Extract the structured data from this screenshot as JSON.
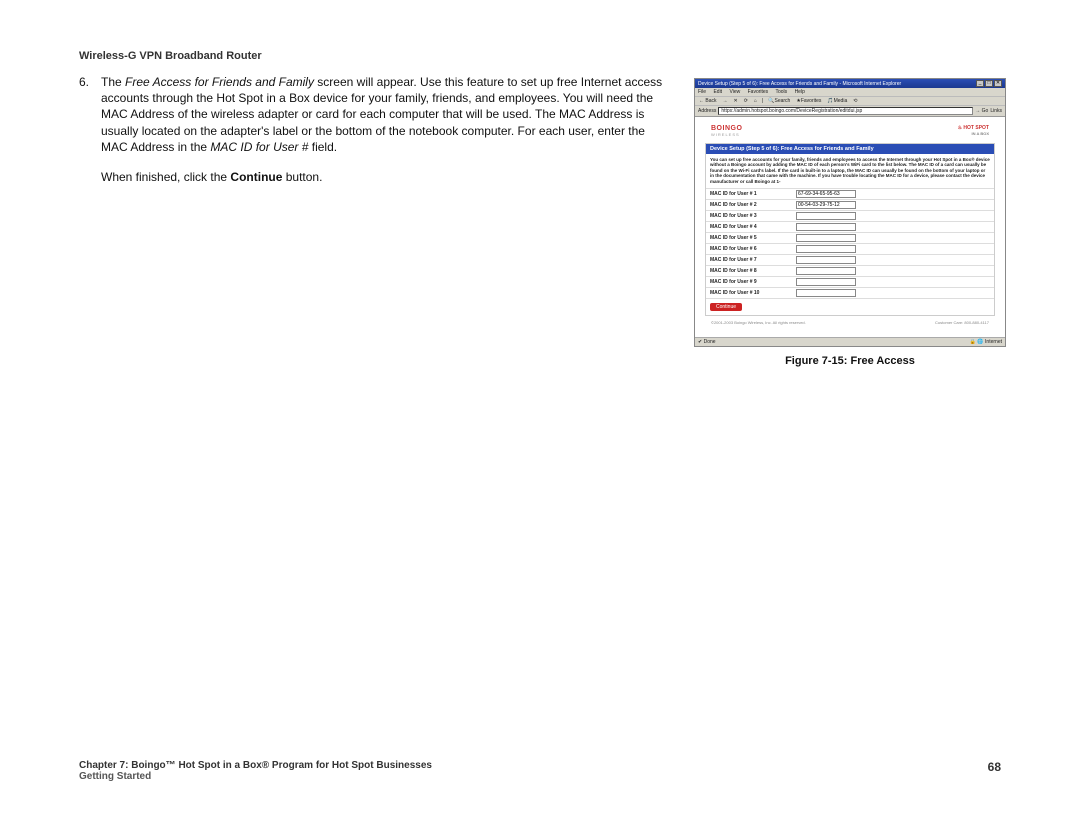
{
  "header": {
    "title": "Wireless-G VPN Broadband Router"
  },
  "body": {
    "step_number": "6.",
    "para1_prefix": "The ",
    "para1_italic": "Free Access for Friends and Family",
    "para1_mid": " screen will appear. Use this feature to set up free Internet access accounts through the Hot Spot in a Box device for your family, friends, and employees. You will need the MAC Address of the wireless adapter or card for each computer that will be used. The MAC Address is usually located on the adapter's label or the bottom of the notebook computer. For each user, enter the MAC Address in the ",
    "para1_italic2": "MAC ID for User #",
    "para1_suffix": " field.",
    "para2_prefix": "When finished, click the ",
    "para2_bold": "Continue",
    "para2_suffix": " button."
  },
  "figure": {
    "window_title": "Device Setup (Step 5 of 6): Free Access for Friends and Family - Microsoft Internet Explorer",
    "menu": {
      "file": "File",
      "edit": "Edit",
      "view": "View",
      "favorites": "Favorites",
      "tools": "Tools",
      "help": "Help"
    },
    "toolbar": {
      "back": "← Back",
      "fwd": "→",
      "stop": "✕",
      "refresh": "⟳",
      "home": "⌂",
      "search": "🔍Search",
      "favorites": "★Favorites",
      "media": "🎵Media",
      "history": "⟲"
    },
    "address_label": "Address",
    "address_url": "https://admin.hotspot.boingo.com/DeviceRegistration/editdui.jsp",
    "go": "→ Go",
    "links": "Links",
    "boingo": "BOINGO",
    "boingo_sub": "WIRELESS",
    "hotspot": "♨ HOT SPOT",
    "hotspot_sub": "IN A BOX",
    "blue_bar": "Device Setup (Step 5 of 6): Free Access for Friends and Family",
    "instructions": "You can set up free accounts for your family, friends and employees to access the Internet through your Hot Spot in a Box® device without a Boingo account by adding the MAC ID of each person's WiFi card to the list below. The MAC ID of a card can usually be found on the Wi-Fi card's label. If the card is built-in to a laptop, the MAC ID can usually be found on the bottom of your laptop or in the documentation that came with the machine. If you have trouble locating the MAC ID for a device, please contact the device manufacturer or call Boingo at 1-",
    "rows": [
      {
        "label": "MAC ID for User # 1",
        "value": "67-69-34-65-95-63"
      },
      {
        "label": "MAC ID for User # 2",
        "value": "00-54-03-29-75-12"
      },
      {
        "label": "MAC ID for User # 3",
        "value": ""
      },
      {
        "label": "MAC ID for User # 4",
        "value": ""
      },
      {
        "label": "MAC ID for User # 5",
        "value": ""
      },
      {
        "label": "MAC ID for User # 6",
        "value": ""
      },
      {
        "label": "MAC ID for User # 7",
        "value": ""
      },
      {
        "label": "MAC ID for User # 8",
        "value": ""
      },
      {
        "label": "MAC ID for User # 9",
        "value": ""
      },
      {
        "label": "MAC ID for User # 10",
        "value": ""
      }
    ],
    "continue": "Continue",
    "footer_left": "©2001-2003 Boingo Wireless, Inc. All rights reserved.",
    "footer_right": "Customer Care: 800-880-4117",
    "status_done": "✔ Done",
    "status_zone": "🔒 🌐 Internet",
    "caption": "Figure 7-15: Free Access"
  },
  "footer": {
    "chapter": "Chapter 7: Boingo™ Hot Spot in a Box® Program for Hot Spot Businesses",
    "section": "Getting Started",
    "page": "68"
  }
}
